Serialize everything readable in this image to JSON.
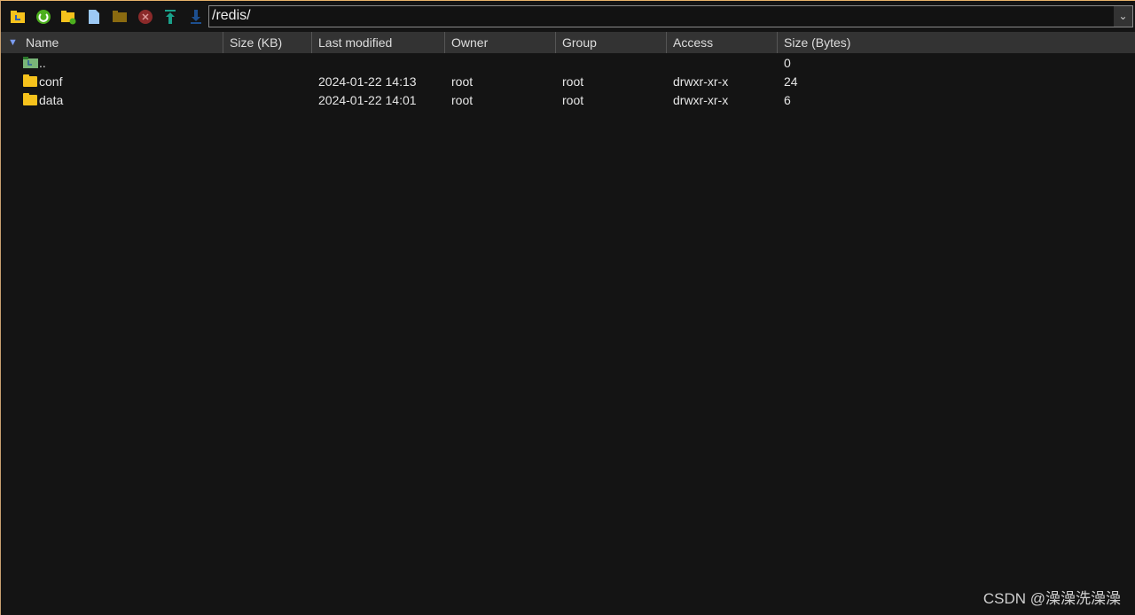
{
  "toolbar": {
    "path": "/redis/",
    "icons": [
      "folder-up-icon",
      "refresh-icon",
      "new-folder-icon",
      "new-file-icon",
      "folder-icon",
      "delete-icon",
      "upload-icon",
      "download-icon"
    ]
  },
  "columns": [
    "Name",
    "Size (KB)",
    "Last modified",
    "Owner",
    "Group",
    "Access",
    "Size (Bytes)"
  ],
  "rows": [
    {
      "name": "..",
      "size_kb": "",
      "modified": "",
      "owner": "",
      "group": "",
      "access": "",
      "size_bytes": "0"
    },
    {
      "name": "conf",
      "size_kb": "",
      "modified": "2024-01-22 14:13",
      "owner": "root",
      "group": "root",
      "access": "drwxr-xr-x",
      "size_bytes": "24"
    },
    {
      "name": "data",
      "size_kb": "",
      "modified": "2024-01-22 14:01",
      "owner": "root",
      "group": "root",
      "access": "drwxr-xr-x",
      "size_bytes": "6"
    }
  ],
  "watermark": "CSDN @澡澡洗澡澡"
}
